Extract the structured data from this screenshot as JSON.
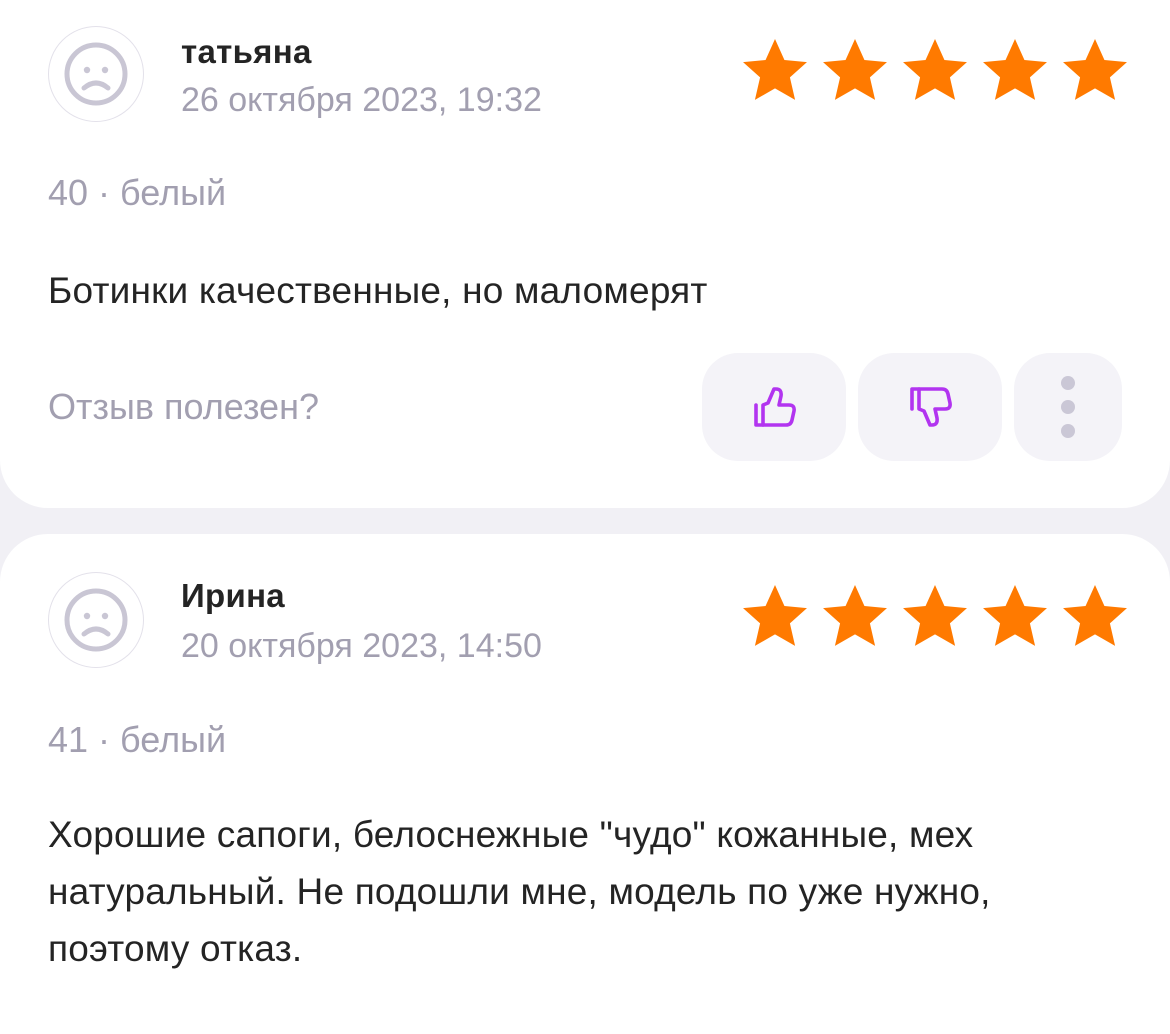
{
  "colors": {
    "star": "#ff7a00",
    "accent": "#b234f0",
    "muted": "#a29fb0",
    "text": "#242424",
    "background": "#f1f0f5"
  },
  "reviews": [
    {
      "author": "татьяна",
      "date": "26 октября 2023, 19:32",
      "rating": 5,
      "variant": "40 · белый",
      "text": "Ботинки качественные, но маломерят",
      "helpful_prompt": "Отзыв полезен?",
      "icons": {
        "avatar": "sad-face-icon",
        "like": "thumbs-up-icon",
        "dislike": "thumbs-down-icon",
        "more": "more-vertical-icon"
      }
    },
    {
      "author": "Ирина",
      "date": "20 октября 2023, 14:50",
      "rating": 5,
      "variant": "41 · белый",
      "text": "Хорошие сапоги, белоснежные \"чудо\" кожанные, мех натуральный. Не подошли мне, модель по уже нужно, поэтому отказ.",
      "icons": {
        "avatar": "sad-face-icon"
      }
    }
  ]
}
